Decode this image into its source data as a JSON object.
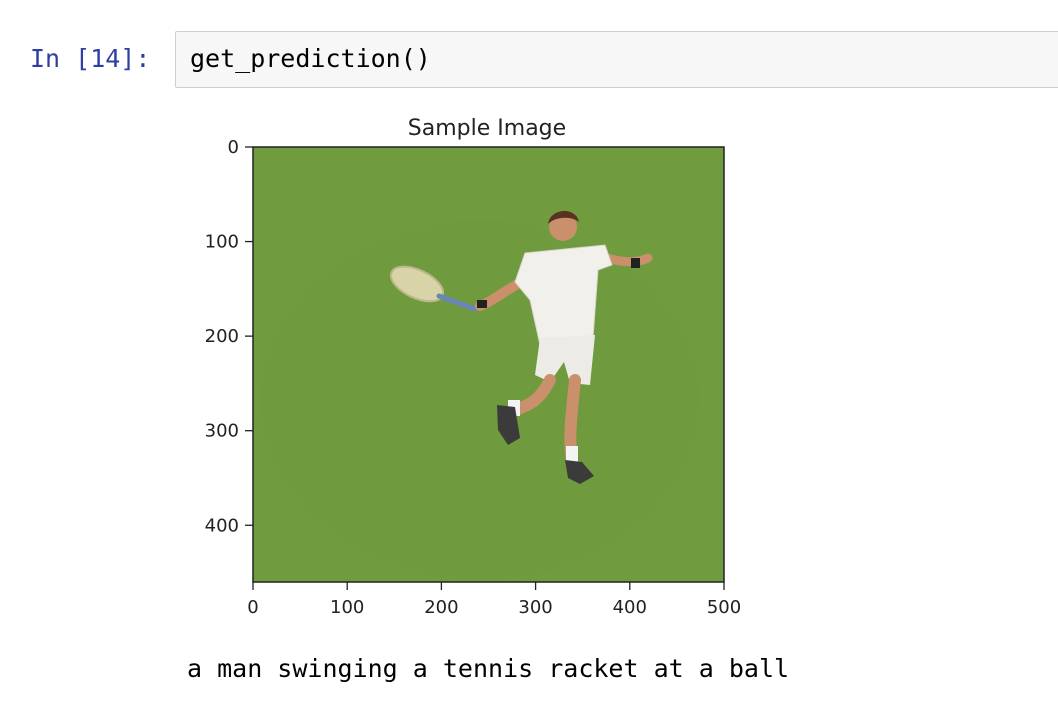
{
  "cell": {
    "prompt": "In [14]:",
    "code": "get_prediction()"
  },
  "chart_data": {
    "type": "image",
    "title": "Sample Image",
    "xlim": [
      0,
      500
    ],
    "ylim": [
      460,
      0
    ],
    "x_ticks": [
      0,
      100,
      200,
      300,
      400,
      500
    ],
    "y_ticks": [
      0,
      100,
      200,
      300,
      400
    ],
    "x_tick_labels": [
      "0",
      "100",
      "200",
      "300",
      "400",
      "500"
    ],
    "y_tick_labels": [
      "0",
      "100",
      "200",
      "300",
      "400"
    ],
    "image_description_colors": {
      "court": "#6e9a3e",
      "shirt": "#f2f0ea",
      "skin": "#c9906b",
      "hair": "#5a3320"
    }
  },
  "output": {
    "caption": "a man swinging a tennis racket at a ball"
  }
}
